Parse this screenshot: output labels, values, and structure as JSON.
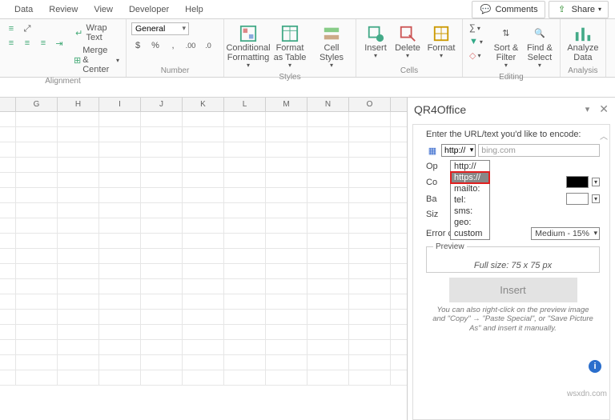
{
  "menubar": {
    "tabs": [
      "Data",
      "Review",
      "View",
      "Developer",
      "Help"
    ],
    "comments": "Comments",
    "share": "Share"
  },
  "ribbon": {
    "alignment": {
      "wrap": "Wrap Text",
      "merge": "Merge & Center",
      "label": "Alignment"
    },
    "number": {
      "format": "General",
      "label": "Number"
    },
    "styles": {
      "cond": "Conditional Formatting",
      "table": "Format as Table",
      "cell": "Cell Styles",
      "label": "Styles"
    },
    "cells": {
      "insert": "Insert",
      "delete": "Delete",
      "format": "Format",
      "label": "Cells"
    },
    "editing": {
      "sort": "Sort & Filter",
      "find": "Find & Select",
      "label": "Editing"
    },
    "analysis": {
      "analyze": "Analyze Data",
      "label": "Analysis"
    }
  },
  "columns": [
    "G",
    "H",
    "I",
    "J",
    "K",
    "L",
    "M",
    "N",
    "O"
  ],
  "pane": {
    "title": "QR4Office",
    "prompt": "Enter the URL/text you'd like to encode:",
    "protocol_selected": "http://",
    "url_placeholder": "bing.com",
    "dropdown_options": [
      "http://",
      "https://",
      "mailto:",
      "tel:",
      "sms:",
      "geo:",
      "custom"
    ],
    "opt_rows": {
      "op": "Op",
      "co": "Co",
      "ba": "Ba",
      "siz": "Siz"
    },
    "err_label": "Error correction:",
    "err_value": "Medium - 15%",
    "preview_label": "Preview",
    "preview_size": "Full size: 75 x 75 px",
    "insert": "Insert",
    "hint": "You can also right-click on the preview image and \"Copy\" → \"Paste Special\", or \"Save Picture As\" and insert it manually."
  },
  "watermark": "wsxdn.com"
}
